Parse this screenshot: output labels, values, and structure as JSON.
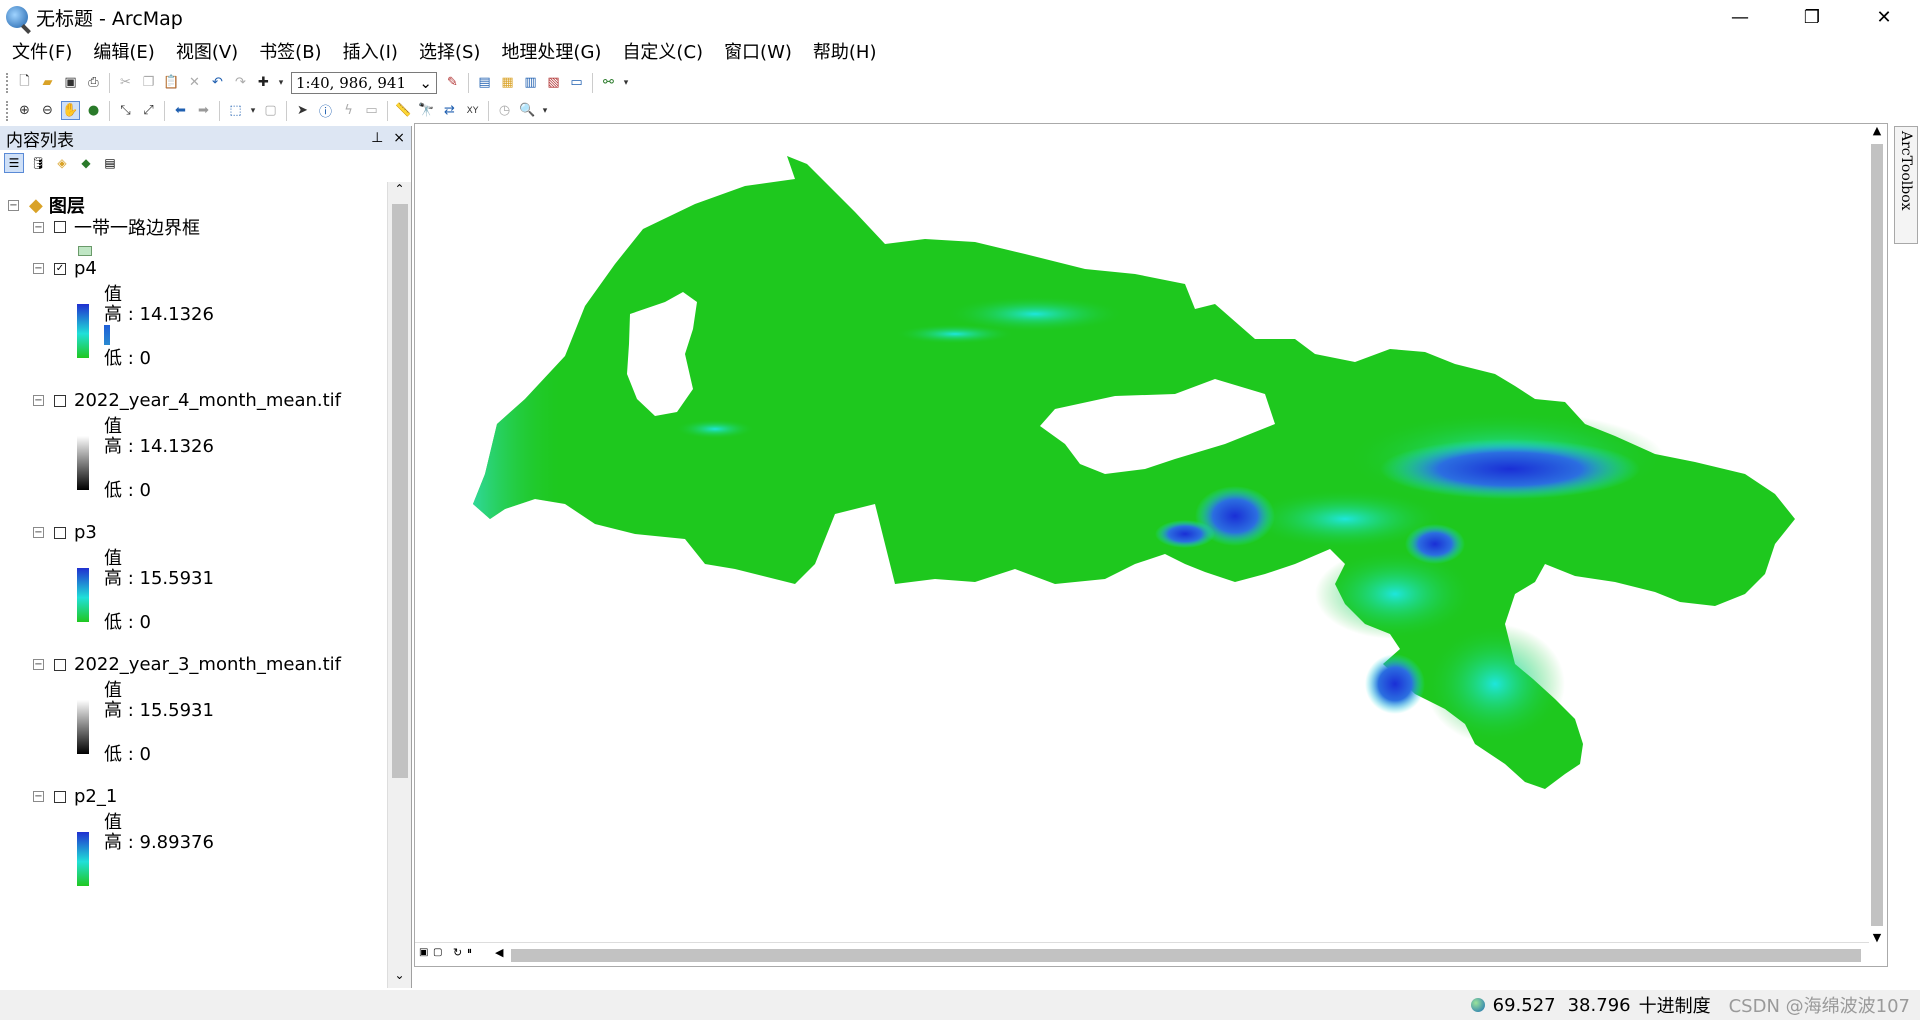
{
  "window": {
    "title": "无标题 - ArcMap",
    "minimize": "—",
    "maximize": "❐",
    "close": "✕"
  },
  "menu": [
    "文件(F)",
    "编辑(E)",
    "视图(V)",
    "书签(B)",
    "插入(I)",
    "选择(S)",
    "地理处理(G)",
    "自定义(C)",
    "窗口(W)",
    "帮助(H)"
  ],
  "toolbar": {
    "scale": "1:40, 986, 941",
    "scale_arrow": "⌄"
  },
  "toc": {
    "title": "内容列表",
    "pin": "⊥",
    "close": "×",
    "root": "图层",
    "layers": [
      {
        "name": "一带一路边界框",
        "checked": false
      },
      {
        "name": "p4",
        "checked": true,
        "value_label": "值",
        "high": "高 : 14.1326",
        "low": "低 : 0"
      },
      {
        "name": "2022_year_4_month_mean.tif",
        "checked": false,
        "value_label": "值",
        "high": "高 : 14.1326",
        "low": "低 : 0"
      },
      {
        "name": "p3",
        "checked": false,
        "value_label": "值",
        "high": "高 : 15.5931",
        "low": "低 : 0"
      },
      {
        "name": "2022_year_3_month_mean.tif",
        "checked": false,
        "value_label": "值",
        "high": "高 : 15.5931",
        "low": "低 : 0"
      },
      {
        "name": "p2_1",
        "checked": false,
        "value_label": "值",
        "high": "高 : 9.89376"
      }
    ]
  },
  "arctoolbox": "ArcToolbox",
  "status": {
    "x": "69.527",
    "y": "38.796",
    "units": "十进制度",
    "watermark": "CSDN @海绵波波107"
  },
  "colors": {
    "raster_low": "#1ec81e",
    "raster_mid": "#1ee6dc",
    "raster_high": "#1a2fd6",
    "toc_header": "#dde6f3"
  }
}
